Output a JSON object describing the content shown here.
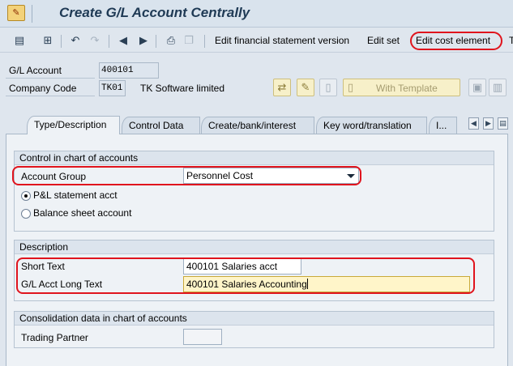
{
  "title": {
    "text": "Create G/L Account Centrally",
    "app_icon": "sap-transaction-icon"
  },
  "toolbar": {
    "icons": [
      "edit-toggle-icon",
      "hierarchy-icon",
      "undo-icon",
      "redo-icon",
      "previous-icon",
      "next-icon",
      "print-icon",
      "new-icon"
    ],
    "edit_fs_version": "Edit financial statement version",
    "edit_set": "Edit set",
    "edit_cost_element": "Edit cost element",
    "overflow_text": "T"
  },
  "header": {
    "gl_account_label": "G/L Account",
    "gl_account_value": "400101",
    "company_code_label": "Company Code",
    "company_code_value": "TK01",
    "company_name": "TK Software limited",
    "with_template_label": "With Template"
  },
  "tabs": [
    {
      "label": "Type/Description",
      "active": true
    },
    {
      "label": "Control Data",
      "active": false
    },
    {
      "label": "Create/bank/interest",
      "active": false
    },
    {
      "label": "Key word/translation",
      "active": false
    },
    {
      "label": "I...",
      "active": false
    }
  ],
  "control_group": {
    "header": "Control in chart of accounts",
    "account_group_label": "Account Group",
    "account_group_value": "Personnel Cost",
    "pl_label": "P&L statement acct",
    "bs_label": "Balance sheet account",
    "selected": "pl"
  },
  "description_group": {
    "header": "Description",
    "short_text_label": "Short Text",
    "short_text_value": "400101 Salaries acct",
    "long_text_label": "G/L Acct Long Text",
    "long_text_value": "400101 Salaries Accounting"
  },
  "consolidation_group": {
    "header": "Consolidation data in chart of accounts",
    "trading_partner_label": "Trading Partner",
    "trading_partner_value": ""
  },
  "colors": {
    "highlight": "#e0141d",
    "title_text": "#1f3a55",
    "background": "#dfe6ee"
  }
}
